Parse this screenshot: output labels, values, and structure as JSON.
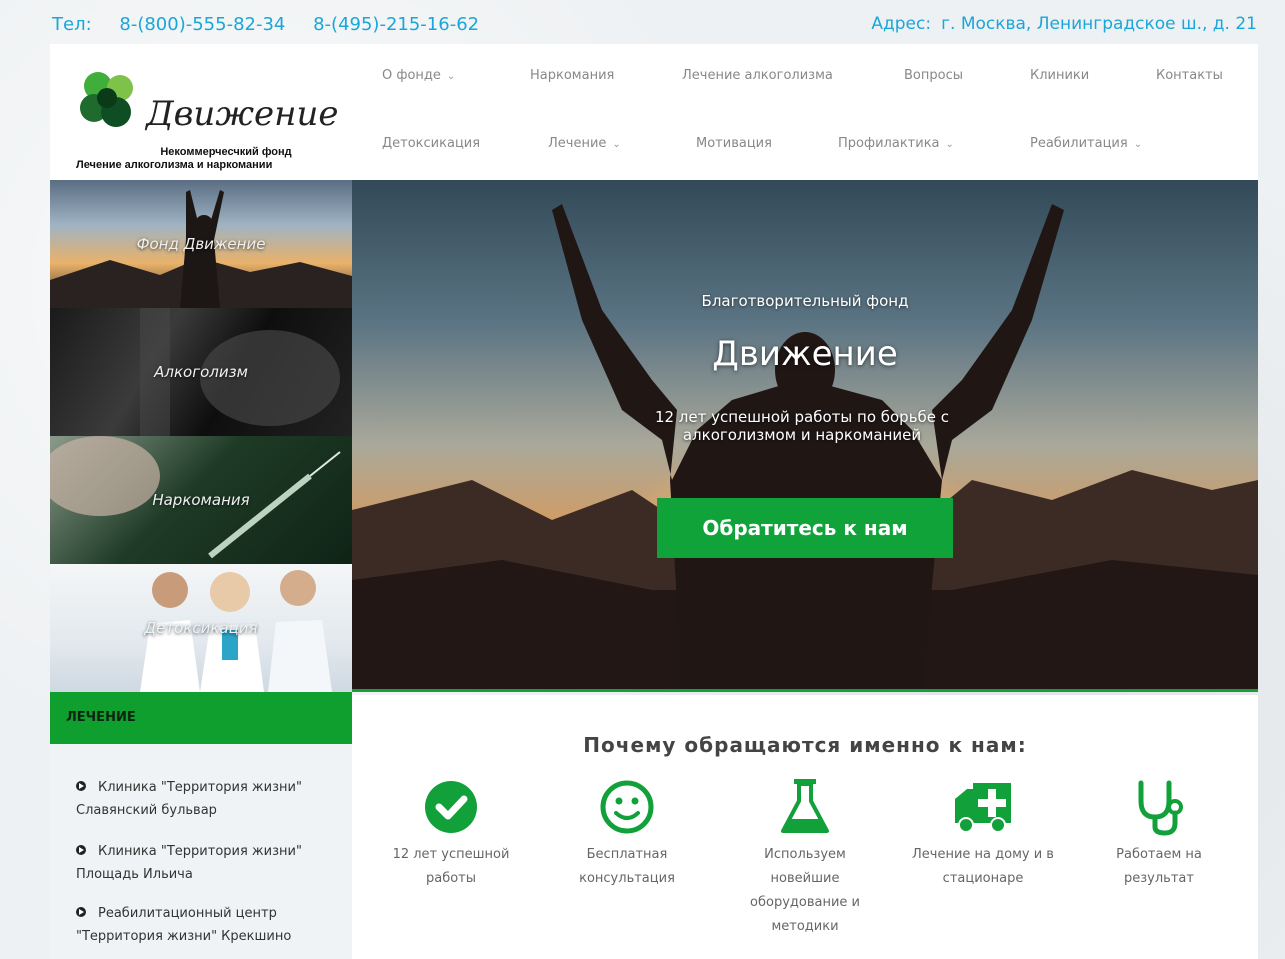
{
  "contacts": {
    "phone_label": "Тел:",
    "phone1": "8-(800)-555-82-34",
    "phone2": "8-(495)-215-16-62",
    "address_label": "Адрес:",
    "address": "г. Москва, Ленинградское ш., д. 21"
  },
  "logo": {
    "brand": "Движение",
    "tagline1": "Некоммерчесчкий фонд",
    "tagline2": "Лечение алкоголизма и наркомании"
  },
  "nav": {
    "row1": [
      {
        "label": "О фонде",
        "dropdown": true
      },
      {
        "label": "Наркомания",
        "dropdown": false
      },
      {
        "label": "Лечение алкоголизма",
        "dropdown": false
      },
      {
        "label": "Вопросы",
        "dropdown": false
      },
      {
        "label": "Клиники",
        "dropdown": false
      },
      {
        "label": "Контакты",
        "dropdown": false
      }
    ],
    "row2": [
      {
        "label": "Детоксикация",
        "dropdown": false
      },
      {
        "label": "Лечение",
        "dropdown": true
      },
      {
        "label": "Мотивация",
        "dropdown": false
      },
      {
        "label": "Профилактика",
        "dropdown": true
      },
      {
        "label": "Реабилитация",
        "dropdown": true
      }
    ]
  },
  "tiles": [
    {
      "label": "Фонд Движение"
    },
    {
      "label": "Алкоголизм"
    },
    {
      "label": "Наркомания"
    },
    {
      "label": "Детоксикация"
    }
  ],
  "sidebar": {
    "heading": "ЛЕЧЕНИЕ",
    "items": [
      {
        "label": "Клиника \"Территория жизни\" Славянский бульвар"
      },
      {
        "label": "Клиника \"Территория жизни\" Площадь Ильича"
      },
      {
        "label": "Реабилитационный центр \"Территория жизни\" Крекшино"
      }
    ]
  },
  "hero": {
    "subtitle": "Благотворительный фонд",
    "title": "Движение",
    "description": "12 лет успешной работы по борьбе с алкоголизмом и наркоманией",
    "cta": "Обратитесь к нам"
  },
  "features": {
    "heading": "Почему обращаются именно к нам:",
    "items": [
      {
        "icon": "check-circle-icon",
        "label": "12 лет успешной работы"
      },
      {
        "icon": "smile-icon",
        "label": "Бесплатная консультация"
      },
      {
        "icon": "flask-icon",
        "label": "Используем новейшие оборудование и методики"
      },
      {
        "icon": "ambulance-icon",
        "label": "Лечение на дому и в стационаре"
      },
      {
        "icon": "stethoscope-icon",
        "label": "Работаем на результат"
      }
    ]
  },
  "colors": {
    "accent_green": "#0fa33a",
    "link_blue": "#1aa6d9"
  }
}
